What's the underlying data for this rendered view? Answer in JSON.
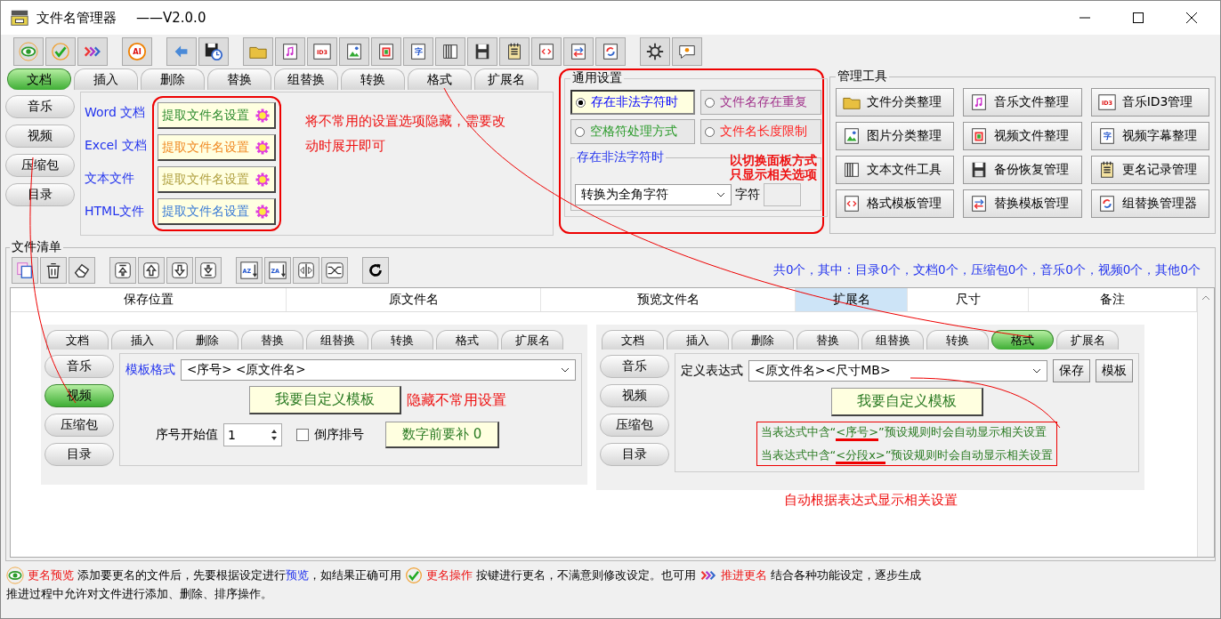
{
  "window": {
    "title": "文件名管理器",
    "version": "——V2.0.0"
  },
  "toolbar": [
    {
      "kind": "eye"
    },
    {
      "kind": "check"
    },
    {
      "kind": "forward"
    },
    {
      "kind": "ai",
      "glyph": "AI"
    },
    {
      "kind": "undo"
    },
    {
      "kind": "saveclock"
    },
    {
      "kind": "folder"
    },
    {
      "kind": "music"
    },
    {
      "kind": "id3",
      "glyph": "ID3"
    },
    {
      "kind": "picture"
    },
    {
      "kind": "video"
    },
    {
      "kind": "subtitle",
      "glyph": "字"
    },
    {
      "kind": "pages"
    },
    {
      "kind": "floppy"
    },
    {
      "kind": "notepad"
    },
    {
      "kind": "format"
    },
    {
      "kind": "swap"
    },
    {
      "kind": "refresh"
    },
    {
      "kind": "gear"
    },
    {
      "kind": "chat"
    }
  ],
  "main_tabs": [
    {
      "label": "文档",
      "selected": true
    },
    {
      "label": "插入",
      "selected": false
    },
    {
      "label": "删除",
      "selected": false
    },
    {
      "label": "替换",
      "selected": false
    },
    {
      "label": "组替换",
      "selected": false
    },
    {
      "label": "转换",
      "selected": false
    },
    {
      "label": "格式",
      "selected": false
    },
    {
      "label": "扩展名",
      "selected": false
    }
  ],
  "side_tabs": [
    {
      "label": "音乐",
      "selected": false
    },
    {
      "label": "视频",
      "selected": false
    },
    {
      "label": "压缩包",
      "selected": false
    },
    {
      "label": "目录",
      "selected": false
    }
  ],
  "doc_rows": [
    {
      "label": "Word 文档",
      "button": "提取文件名设置",
      "color": "#2e8b2e"
    },
    {
      "label": "Excel 文档",
      "button": "提取文件名设置",
      "color": "#f08a24"
    },
    {
      "label": "文本文件",
      "button": "提取文件名设置",
      "color": "#b0a040"
    },
    {
      "label": "HTML文件",
      "button": "提取文件名设置",
      "color": "#3a7bd5"
    }
  ],
  "callout_hidden": "将不常用的设置选项隐藏，需要改动时展开即可",
  "general_settings": {
    "title": "通用设置",
    "options": [
      {
        "label": "存在非法字符时",
        "selected": true,
        "color": "#0000ff"
      },
      {
        "label": "文件名存在重复",
        "selected": false,
        "color": "#a0308a"
      },
      {
        "label": "空格符处理方式",
        "selected": false,
        "color": "#2a9a2a"
      },
      {
        "label": "文件名长度限制",
        "selected": false,
        "color": "#ff2020"
      }
    ],
    "sub_title": "存在非法字符时",
    "select": "转换为全角字符",
    "unit": "字符",
    "callout": [
      "以切换面板方式",
      "只显示相关选项"
    ]
  },
  "tools": {
    "title": "管理工具",
    "items": [
      {
        "kind": "folder",
        "label": "文件分类整理"
      },
      {
        "kind": "music",
        "label": "音乐文件整理"
      },
      {
        "kind": "id3",
        "glyph": "ID3",
        "label": "音乐ID3管理"
      },
      {
        "kind": "picture",
        "label": "图片分类整理"
      },
      {
        "kind": "video",
        "label": "视频文件整理"
      },
      {
        "kind": "subtitle",
        "glyph": "字",
        "label": "视频字幕整理"
      },
      {
        "kind": "pages",
        "label": "文本文件工具"
      },
      {
        "kind": "floppy",
        "label": "备份恢复管理"
      },
      {
        "kind": "notepad",
        "label": "更名记录管理"
      },
      {
        "kind": "format",
        "label": "格式模板管理"
      },
      {
        "kind": "swap",
        "label": "替换模板管理"
      },
      {
        "kind": "refresh",
        "label": "组替换管理器"
      }
    ]
  },
  "file_list": {
    "title": "文件清单",
    "toolbar": [
      {
        "kind": "copy"
      },
      {
        "kind": "trash"
      },
      {
        "kind": "clean"
      },
      {
        "kind": "top"
      },
      {
        "kind": "up"
      },
      {
        "kind": "down"
      },
      {
        "kind": "bottom"
      },
      {
        "kind": "az",
        "glyph": "AZ"
      },
      {
        "kind": "za",
        "glyph": "ZA"
      },
      {
        "kind": "mirror"
      },
      {
        "kind": "shuffle"
      },
      {
        "kind": "reload"
      }
    ],
    "summary": "共0个，其中：目录0个，文档0个，压缩包0个，音乐0个，视频0个，其他0个",
    "columns": [
      {
        "label": "保存位置",
        "selected": false
      },
      {
        "label": "原文件名",
        "selected": false
      },
      {
        "label": "预览文件名",
        "selected": false
      },
      {
        "label": "扩展名",
        "selected": true
      },
      {
        "label": "尺寸",
        "selected": false
      },
      {
        "label": "备注",
        "selected": false
      }
    ]
  },
  "inset_left": {
    "tabs": [
      {
        "label": "文档",
        "selected": false
      },
      {
        "label": "插入",
        "selected": false
      },
      {
        "label": "删除",
        "selected": false
      },
      {
        "label": "替换",
        "selected": false
      },
      {
        "label": "组替换",
        "selected": false
      },
      {
        "label": "转换",
        "selected": false
      },
      {
        "label": "格式",
        "selected": false
      },
      {
        "label": "扩展名",
        "selected": false
      }
    ],
    "side_tabs": [
      {
        "label": "音乐",
        "selected": false
      },
      {
        "label": "视频",
        "selected": true
      },
      {
        "label": "压缩包",
        "selected": false
      },
      {
        "label": "目录",
        "selected": false
      }
    ],
    "template_label": "模板格式",
    "template_value": "<序号>  <原文件名>",
    "custom_button": "我要自定义模板",
    "callout": "隐藏不常用设置",
    "start_label": "序号开始值",
    "start_value": "1",
    "reverse": {
      "label": "倒序排号",
      "checked": false
    },
    "pad_button": "数字前要补  0"
  },
  "inset_right": {
    "tabs": [
      {
        "label": "文档",
        "selected": false
      },
      {
        "label": "插入",
        "selected": false
      },
      {
        "label": "删除",
        "selected": false
      },
      {
        "label": "替换",
        "selected": false
      },
      {
        "label": "组替换",
        "selected": false
      },
      {
        "label": "转换",
        "selected": false
      },
      {
        "label": "格式",
        "selected": true
      },
      {
        "label": "扩展名",
        "selected": false
      }
    ],
    "side_tabs": [
      {
        "label": "音乐",
        "selected": false
      },
      {
        "label": "视频",
        "selected": false
      },
      {
        "label": "压缩包",
        "selected": false
      },
      {
        "label": "目录",
        "selected": false
      }
    ],
    "expr_label": "定义表达式",
    "expr_value": "<原文件名><尺寸MB>",
    "buttons": [
      "保存",
      "模板"
    ],
    "custom_button": "我要自定义模板",
    "notes": [
      {
        "before": "当表达式中含“",
        "key": "<序号>",
        "after": "”预设规则时会自动显示相关设置"
      },
      {
        "before": "当表达式中含“",
        "key": "<分段x>",
        "after": "”预设规则时会自动显示相关设置"
      }
    ],
    "callout": "自动根据表达式显示相关设置"
  },
  "status_bar": {
    "lines": [
      [
        {
          "kind": "eye"
        },
        {
          "kind": "title",
          "text": "更名预览"
        },
        {
          "kind": "text",
          "text": "添加要更名的文件后，先要根据设定进行"
        },
        {
          "kind": "link",
          "text": "预览"
        },
        {
          "kind": "text",
          "text": "，如结果正确可用"
        },
        {
          "kind": "check"
        },
        {
          "kind": "title",
          "text": "更名操作"
        },
        {
          "kind": "text",
          "text": "按键进行更名，不满意则修改设定。也可用"
        },
        {
          "kind": "forward"
        },
        {
          "kind": "title",
          "text": "推进更名"
        },
        {
          "kind": "text",
          "text": "结合各种功能设定，逐步生成"
        }
      ],
      [
        {
          "kind": "text",
          "text": "推进过程中允许对文件进行添加、删除、排序操作。"
        }
      ]
    ]
  }
}
